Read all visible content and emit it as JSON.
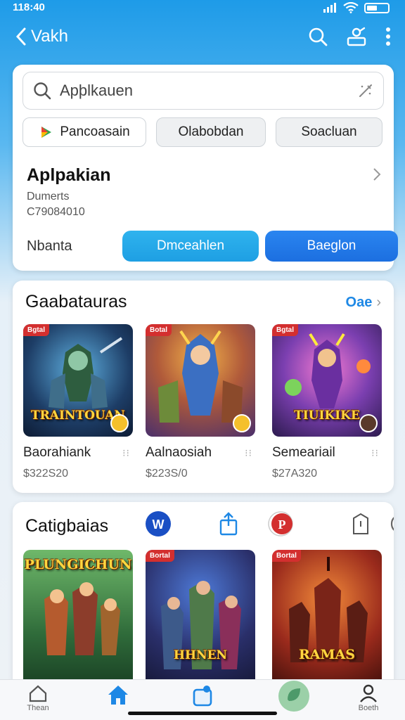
{
  "status_bar": {
    "time": "118:40"
  },
  "nav": {
    "back_label": "Vakh",
    "icons": [
      "search-icon",
      "share-icon",
      "more-icon"
    ]
  },
  "search": {
    "placeholder": "Apþlkauen"
  },
  "chips": [
    "Pancoasain",
    "Olabobdan",
    "Soacluan"
  ],
  "app": {
    "title": "Aplpakian",
    "meta_line1": "Dumerts",
    "meta_line2": "C79084010",
    "row_label": "Nbanta",
    "download_label": "Dmceahlen",
    "begin_label": "Baeglon"
  },
  "games_section": {
    "title": "Gaabatauras",
    "see_all": "Oae",
    "items": [
      {
        "name": "Baorahiank",
        "price": "$322S20",
        "art_text": "TRAINTOUAN",
        "tag": "Bgtal"
      },
      {
        "name": "Aalnaosiah",
        "price": "$223S/0",
        "art_text": "",
        "tag": "Botal"
      },
      {
        "name": "Semeariail",
        "price": "$27A320",
        "art_text": "TIUIKIKE",
        "tag": "Bgtal"
      }
    ]
  },
  "categories_section": {
    "title": "Catigbaias",
    "icons": [
      "brand-w-icon",
      "share-icon",
      "p-badge-icon",
      "tag-icon",
      "partial-icon"
    ],
    "thumbs": [
      {
        "art_text": "PLUNGICHUN",
        "tag": ""
      },
      {
        "art_text": "HHNEN",
        "tag": "Bortal"
      },
      {
        "art_text": "RAMAS",
        "tag": "Bortal"
      }
    ]
  },
  "tab_bar": {
    "tabs": [
      {
        "label": "Thean",
        "icon": "home-outline-icon"
      },
      {
        "label": "",
        "icon": "home-icon"
      },
      {
        "label": "",
        "icon": "store-icon"
      },
      {
        "label": "",
        "icon": "leaf-icon"
      },
      {
        "label": "Boeth",
        "icon": "profile-icon"
      }
    ]
  },
  "colors": {
    "accent": "#1e88e5",
    "button_download": "#1e9fe3",
    "button_begin": "#1c6fe0",
    "header_bg": "#1e9be8"
  }
}
